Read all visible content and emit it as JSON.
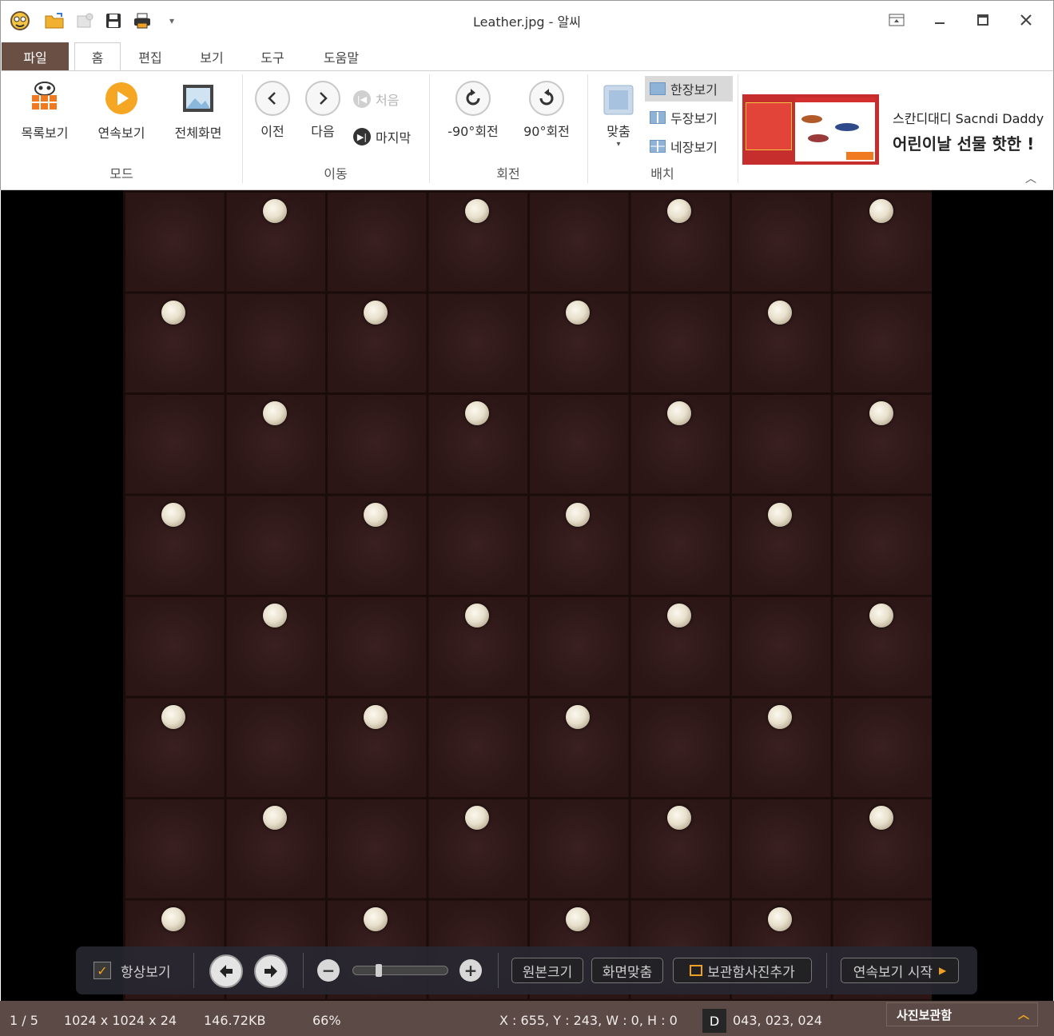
{
  "window": {
    "title": "Leather.jpg - 알씨"
  },
  "tabs": {
    "file": "파일",
    "home": "홈",
    "edit": "편집",
    "view": "보기",
    "tools": "도구",
    "help": "도움말"
  },
  "ribbon": {
    "mode": {
      "group_label": "모드",
      "list_view": "목록보기",
      "slideshow": "연속보기",
      "fullscreen": "전체화면"
    },
    "navigate": {
      "group_label": "이동",
      "prev": "이전",
      "next": "다음",
      "first": "처음",
      "last": "마지막"
    },
    "rotate": {
      "group_label": "회전",
      "ccw": "-90°회전",
      "cw": "90°회전"
    },
    "layout": {
      "group_label": "배치",
      "fit": "맞춤",
      "single": "한장보기",
      "double": "두장보기",
      "quad": "네장보기"
    }
  },
  "ad": {
    "line1": "스칸디대디 Sacndi Daddy",
    "line2": "어린이날 선물 핫한 !"
  },
  "floating_toolbar": {
    "always_show": "항상보기",
    "always_show_checked": true,
    "zoom_level": 0.25,
    "original_size": "원본크기",
    "fit_screen": "화면맞춤",
    "add_to_tray": "보관함사진추가",
    "start_slideshow": "연속보기 시작"
  },
  "status": {
    "page": "1 / 5",
    "dimensions": "1024 x 1024 x 24",
    "file_size": "146.72KB",
    "zoom": "66%",
    "coords": "X : 655, Y : 243, W : 0, H : 0",
    "color_mode": "D",
    "color_value": "043, 023, 024",
    "tray_label": "사진보관함"
  },
  "colors": {
    "accent": "#f0a020",
    "file_tab": "#6a4f45",
    "status_bar": "#5b4a45",
    "leather": "#2b1616"
  }
}
